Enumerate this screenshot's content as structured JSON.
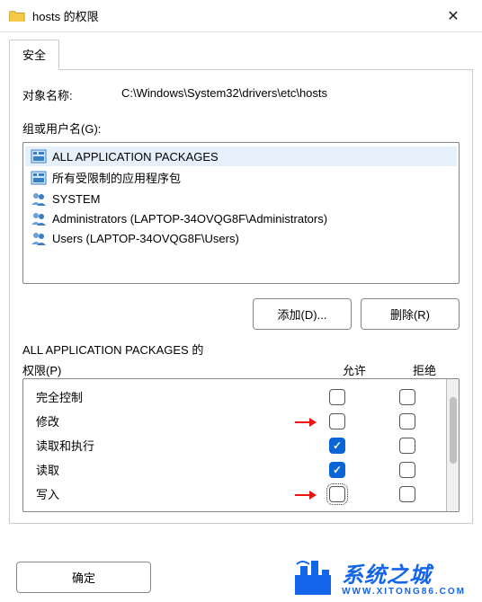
{
  "titlebar": {
    "title": "hosts 的权限",
    "close_glyph": "✕"
  },
  "tabs": {
    "security_label": "安全"
  },
  "object": {
    "label": "对象名称:",
    "value": "C:\\Windows\\System32\\drivers\\etc\\hosts"
  },
  "groups": {
    "label": "组或用户名(G):",
    "items": [
      {
        "name": "ALL APPLICATION PACKAGES",
        "icon": "pkg",
        "selected": true
      },
      {
        "name": "所有受限制的应用程序包",
        "icon": "pkg",
        "selected": false
      },
      {
        "name": "SYSTEM",
        "icon": "usr",
        "selected": false
      },
      {
        "name": "Administrators (LAPTOP-34OVQG8F\\Administrators)",
        "icon": "usr",
        "selected": false
      },
      {
        "name": "Users (LAPTOP-34OVQG8F\\Users)",
        "icon": "usr",
        "selected": false
      }
    ]
  },
  "buttons": {
    "add": "添加(D)...",
    "remove": "删除(R)",
    "ok": "确定"
  },
  "perms": {
    "header_prefix": "ALL APPLICATION PACKAGES 的",
    "header_suffix": "权限(P)",
    "allow_label": "允许",
    "deny_label": "拒绝",
    "rows": [
      {
        "name": "完全控制",
        "allow": false,
        "deny": false,
        "arrow": false,
        "focus": false
      },
      {
        "name": "修改",
        "allow": false,
        "deny": false,
        "arrow": true,
        "focus": false
      },
      {
        "name": "读取和执行",
        "allow": true,
        "deny": false,
        "arrow": false,
        "focus": false
      },
      {
        "name": "读取",
        "allow": true,
        "deny": false,
        "arrow": false,
        "focus": false
      },
      {
        "name": "写入",
        "allow": false,
        "deny": false,
        "arrow": true,
        "focus": true
      }
    ]
  },
  "watermark": {
    "text": "系统之城",
    "sub": "WWW.XITONG86.COM"
  }
}
